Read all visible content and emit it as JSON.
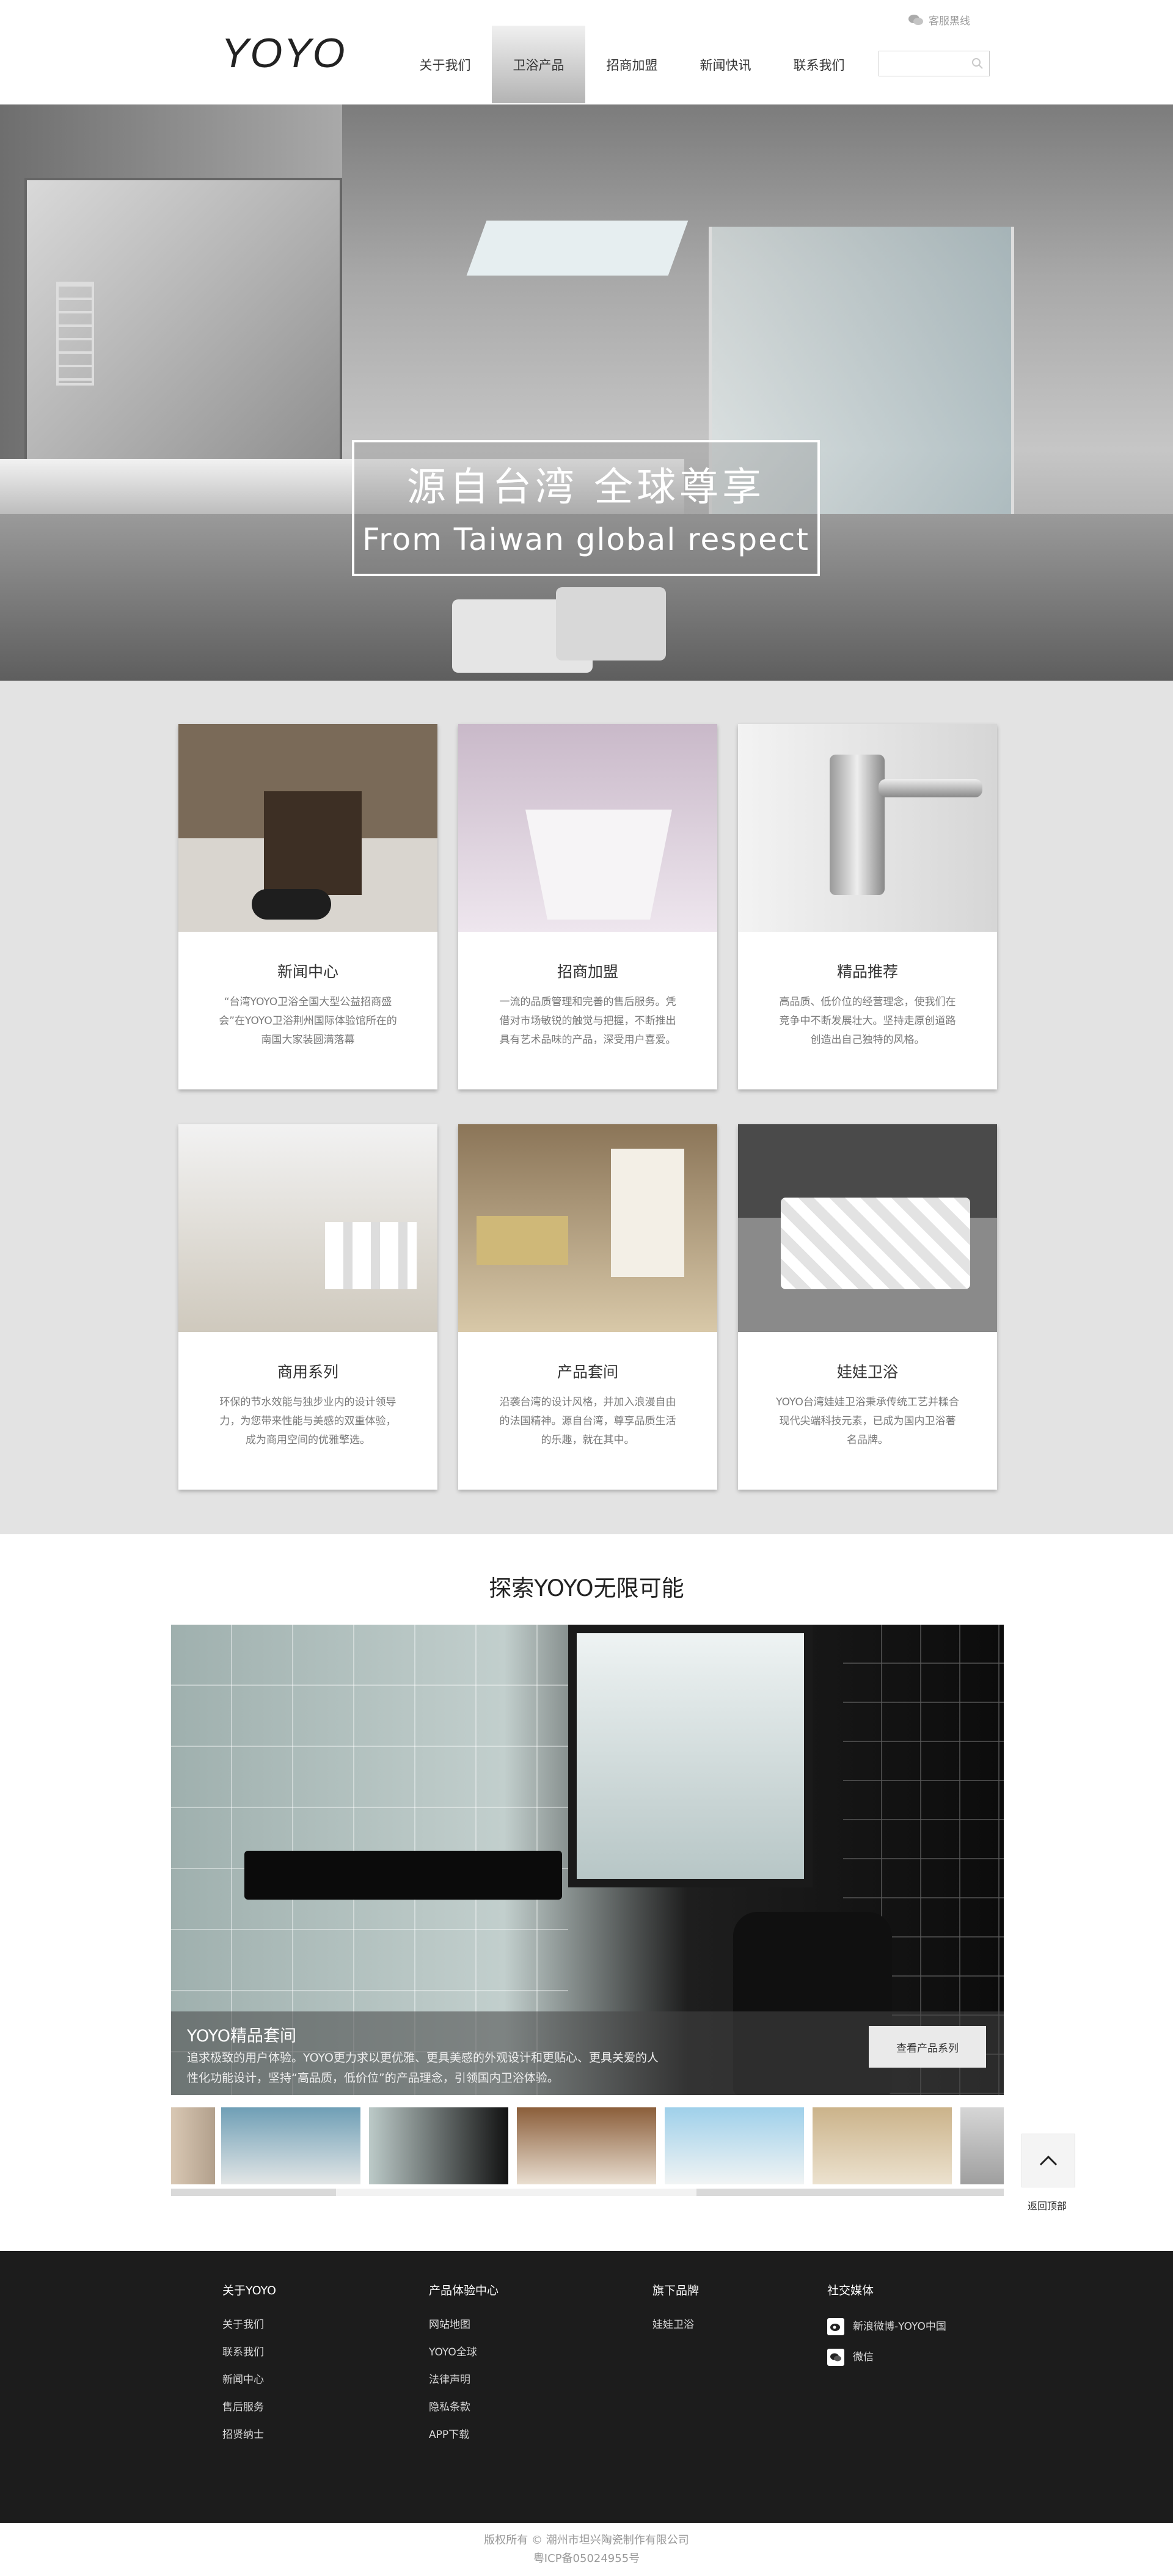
{
  "header": {
    "logo": "YOYO",
    "service_link": "客服黑线",
    "nav": [
      "关于我们",
      "卫浴产品",
      "招商加盟",
      "新闻快讯",
      "联系我们"
    ],
    "active_nav": "卫浴产品",
    "search": {
      "placeholder": "",
      "value": ""
    }
  },
  "hero": {
    "title_cn": "源自台湾  全球尊享",
    "title_en": "From Taiwan global respect"
  },
  "cards": [
    {
      "title": "新闻中心",
      "desc": "“台湾YOYO卫浴全国大型公益招商盛会”在YOYO卫浴荆州国际体验馆所在的南国大家装圆满落幕"
    },
    {
      "title": "招商加盟",
      "desc": "一流的品质管理和完善的售后服务。凭借对市场敏锐的触觉与把握，不断推出具有艺术品味的产品，深受用户喜爱。"
    },
    {
      "title": "精品推荐",
      "desc": "高品质、低价位的经营理念，使我们在竞争中不断发展壮大。坚持走原创道路创造出自己独特的风格。"
    },
    {
      "title": "商用系列",
      "desc": "环保的节水效能与独步业内的设计领导力，为您带来性能与美感的双重体验，成为商用空间的优雅擎选。"
    },
    {
      "title": "产品套间",
      "desc": "沿袭台湾的设计风格，并加入浪漫自由的法国精神。源自台湾，尊享品质生活的乐趣，就在其中。"
    },
    {
      "title": "娃娃卫浴",
      "desc": "YOYO台湾娃娃卫浴秉承传统工艺并糅合现代尖端科技元素，已成为国内卫浴著名品牌。"
    }
  ],
  "explore": {
    "heading": "探索YOYO无限可能",
    "feature_title": "YOYO精品套间",
    "feature_text": "追求极致的用户体验。YOYO更力求以更优雅、更具美感的外观设计和更贴心、更具关爱的人性化功能设计，坚持“高品质，低价位”的产品理念，引领国内卫浴体验。",
    "view_button": "查看产品系列",
    "back_top": "返回顶部"
  },
  "footer": {
    "columns": [
      {
        "head": "关于YOYO",
        "links": [
          "关于我们",
          "联系我们",
          "新闻中心",
          "售后服务",
          "招贤纳士"
        ]
      },
      {
        "head": "产品体验中心",
        "links": [
          "网站地图",
          "YOYO全球",
          "法律声明",
          "隐私条款",
          "APP下载"
        ]
      },
      {
        "head": "旗下品牌",
        "links": [
          "娃娃卫浴"
        ]
      }
    ],
    "social": {
      "head": "社交媒体",
      "items": [
        "新浪微博-YOYO中国",
        "微信"
      ]
    },
    "copyright_line1": "版权所有 © 潮州市坦兴陶瓷制作有限公司",
    "copyright_line2": "粤ICP备05024955号"
  },
  "colors": {
    "footer_bg": "#1c1c1c",
    "cards_bg": "#e3e3e3",
    "nav_active_top": "#f0f0f0",
    "nav_active_bottom": "#b3b3b3"
  }
}
